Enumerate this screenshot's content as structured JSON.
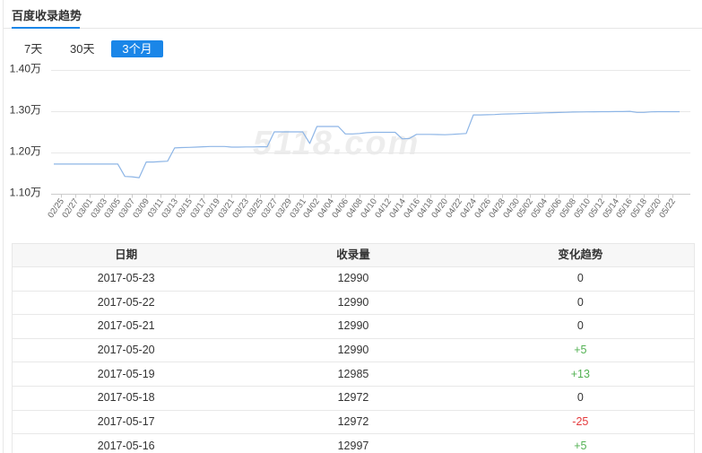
{
  "panel": {
    "title": "百度收录趋势"
  },
  "tabs": [
    {
      "label": "7天",
      "active": false
    },
    {
      "label": "30天",
      "active": false
    },
    {
      "label": "3个月",
      "active": true
    }
  ],
  "watermark": "5118.com",
  "colors": {
    "accent": "#1a86e8",
    "line": "#8db5e6",
    "increase": "#52b152",
    "decrease": "#e4393c"
  },
  "chart_data": {
    "type": "line",
    "x": [
      "02/24",
      "02/25",
      "02/26",
      "02/27",
      "02/28",
      "03/01",
      "03/02",
      "03/03",
      "03/04",
      "03/05",
      "03/06",
      "03/07",
      "03/08",
      "03/09",
      "03/10",
      "03/11",
      "03/12",
      "03/13",
      "03/14",
      "03/15",
      "03/16",
      "03/17",
      "03/18",
      "03/19",
      "03/20",
      "03/21",
      "03/22",
      "03/23",
      "03/24",
      "03/25",
      "03/26",
      "03/27",
      "03/28",
      "03/29",
      "03/30",
      "03/31",
      "04/01",
      "04/02",
      "04/03",
      "04/04",
      "04/05",
      "04/06",
      "04/07",
      "04/08",
      "04/09",
      "04/10",
      "04/11",
      "04/12",
      "04/13",
      "04/14",
      "04/15",
      "04/16",
      "04/17",
      "04/18",
      "04/19",
      "04/20",
      "04/21",
      "04/22",
      "04/23",
      "04/24",
      "04/25",
      "04/26",
      "04/27",
      "04/28",
      "04/29",
      "04/30",
      "05/01",
      "05/02",
      "05/03",
      "05/04",
      "05/05",
      "05/06",
      "05/07",
      "05/08",
      "05/09",
      "05/10",
      "05/11",
      "05/12",
      "05/13",
      "05/14",
      "05/15",
      "05/16",
      "05/17",
      "05/18",
      "05/19",
      "05/20",
      "05/21",
      "05/22",
      "05/23"
    ],
    "series": [
      {
        "values": [
          11720,
          11720,
          11720,
          11720,
          11720,
          11720,
          11720,
          11720,
          11720,
          11720,
          11420,
          11410,
          11390,
          11770,
          11770,
          11780,
          11790,
          12110,
          12120,
          12125,
          12130,
          12140,
          12145,
          12145,
          12145,
          12130,
          12130,
          12135,
          12135,
          12140,
          12140,
          12500,
          12500,
          12500,
          12500,
          12500,
          12220,
          12630,
          12630,
          12630,
          12630,
          12450,
          12450,
          12460,
          12480,
          12490,
          12490,
          12490,
          12490,
          12330,
          12340,
          12440,
          12440,
          12440,
          12435,
          12430,
          12440,
          12450,
          12460,
          12910,
          12910,
          12915,
          12920,
          12930,
          12935,
          12940,
          12945,
          12950,
          12955,
          12960,
          12965,
          12970,
          12975,
          12980,
          12982,
          12985,
          12988,
          12990,
          12990,
          12992,
          12992,
          12997,
          12972,
          12972,
          12985,
          12990,
          12990,
          12990,
          12990
        ]
      }
    ],
    "xticks": [
      "02/25",
      "02/27",
      "03/01",
      "03/03",
      "03/05",
      "03/07",
      "03/09",
      "03/11",
      "03/13",
      "03/15",
      "03/17",
      "03/19",
      "03/21",
      "03/23",
      "03/25",
      "03/27",
      "03/29",
      "03/31",
      "04/02",
      "04/04",
      "04/06",
      "04/08",
      "04/10",
      "04/12",
      "04/14",
      "04/16",
      "04/18",
      "04/20",
      "04/22",
      "04/24",
      "04/26",
      "04/28",
      "04/30",
      "05/02",
      "05/04",
      "05/06",
      "05/08",
      "05/10",
      "05/12",
      "05/14",
      "05/16",
      "05/18",
      "05/20",
      "05/22"
    ],
    "yticks": [
      14000,
      13000,
      12000,
      11000
    ],
    "ytick_labels": [
      "1.40万",
      "1.30万",
      "1.20万",
      "1.10万"
    ],
    "ylim": [
      11000,
      14000
    ],
    "grid": true
  },
  "table": {
    "headers": [
      "日期",
      "收录量",
      "变化趋势"
    ],
    "rows": [
      {
        "date": "2017-05-23",
        "count": "12990",
        "change": "0"
      },
      {
        "date": "2017-05-22",
        "count": "12990",
        "change": "0"
      },
      {
        "date": "2017-05-21",
        "count": "12990",
        "change": "0"
      },
      {
        "date": "2017-05-20",
        "count": "12990",
        "change": "+5"
      },
      {
        "date": "2017-05-19",
        "count": "12985",
        "change": "+13"
      },
      {
        "date": "2017-05-18",
        "count": "12972",
        "change": "0"
      },
      {
        "date": "2017-05-17",
        "count": "12972",
        "change": "-25"
      },
      {
        "date": "2017-05-16",
        "count": "12997",
        "change": "+5"
      }
    ]
  }
}
